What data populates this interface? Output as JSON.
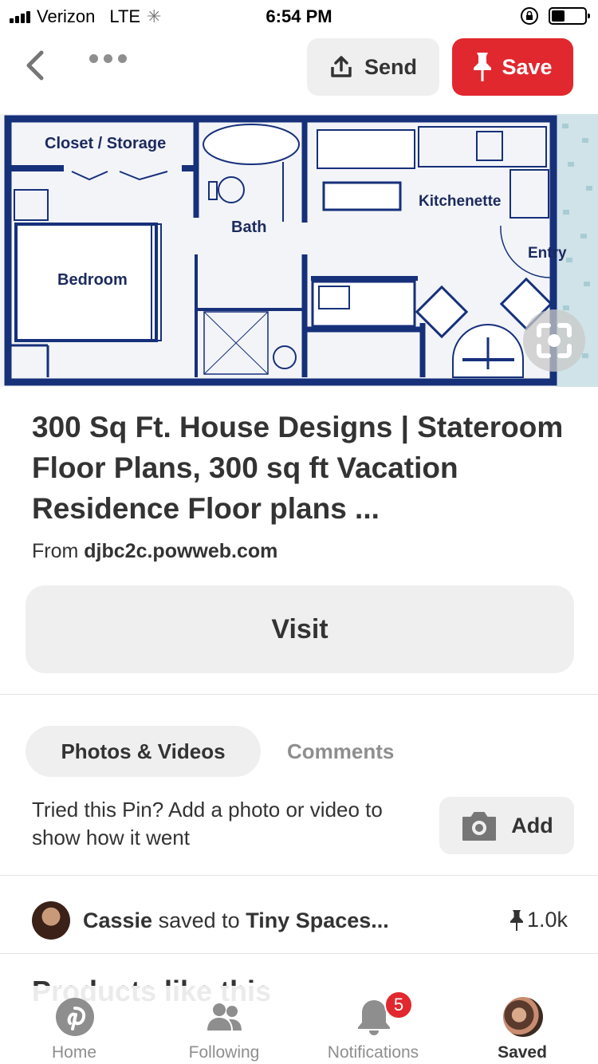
{
  "status_bar": {
    "carrier": "Verizon",
    "network": "LTE",
    "time": "6:54 PM"
  },
  "topnav": {
    "send_label": "Send",
    "save_label": "Save"
  },
  "pin_image": {
    "labels": {
      "closet": "Closet / Storage",
      "bath": "Bath",
      "kitchenette": "Kitchenette",
      "entry": "Entry",
      "bedroom": "Bedroom"
    }
  },
  "pin": {
    "title": "300 Sq Ft. House Designs | Stateroom Floor Plans, 300 sq ft Vacation Residence Floor plans ...",
    "source_prefix": "From",
    "source_domain": "djbc2c.powweb.com",
    "visit_label": "Visit"
  },
  "tabs": {
    "photos_videos": "Photos & Videos",
    "comments": "Comments"
  },
  "tried": {
    "text": "Tried this Pin? Add a photo or video to show how it went",
    "add_label": "Add"
  },
  "saver": {
    "name": "Cassie",
    "action": "saved to",
    "board": "Tiny Spaces...",
    "save_count": "1.0k"
  },
  "products_heading": "Products like this",
  "tabbar": {
    "home": "Home",
    "following": "Following",
    "notifications": "Notifications",
    "notifications_badge": "5",
    "saved": "Saved"
  }
}
